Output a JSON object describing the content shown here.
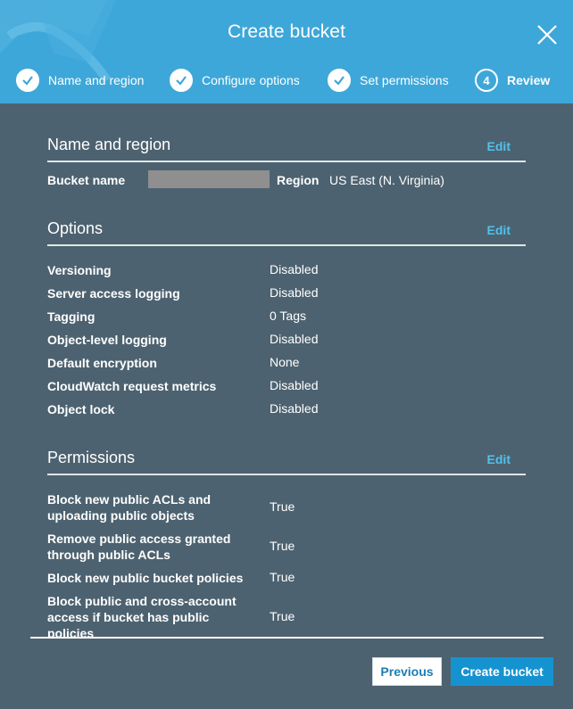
{
  "header": {
    "title": "Create bucket",
    "steps": [
      {
        "label": "Name and region",
        "state": "done"
      },
      {
        "label": "Configure options",
        "state": "done"
      },
      {
        "label": "Set permissions",
        "state": "done"
      },
      {
        "label": "Review",
        "number": "4",
        "state": "active"
      }
    ]
  },
  "name_region": {
    "title": "Name and region",
    "edit": "Edit",
    "bucket_name_label": "Bucket name",
    "region_label": "Region",
    "region_value": "US East (N. Virginia)"
  },
  "options": {
    "title": "Options",
    "edit": "Edit",
    "rows": [
      {
        "key": "Versioning",
        "value": "Disabled"
      },
      {
        "key": "Server access logging",
        "value": "Disabled"
      },
      {
        "key": "Tagging",
        "value": "0 Tags"
      },
      {
        "key": "Object-level logging",
        "value": "Disabled"
      },
      {
        "key": "Default encryption",
        "value": "None"
      },
      {
        "key": "CloudWatch request metrics",
        "value": "Disabled"
      },
      {
        "key": "Object lock",
        "value": "Disabled"
      }
    ]
  },
  "permissions": {
    "title": "Permissions",
    "edit": "Edit",
    "rows": [
      {
        "key_line1": "Block new public ACLs and",
        "key_line2": "uploading public objects",
        "value": "True"
      },
      {
        "key_line1": "Remove public access granted",
        "key_line2": "through public ACLs",
        "value": "True"
      },
      {
        "key_line1": "Block new public bucket policies",
        "value": "True"
      },
      {
        "key_line1": "Block public and cross-account",
        "key_line2": "access if bucket has public",
        "key_line3": "policies",
        "value": "True"
      }
    ]
  },
  "footer": {
    "previous_label": "Previous",
    "create_label": "Create bucket"
  },
  "colors": {
    "header_bg": "#3ea7d9",
    "body_bg": "#4d6270",
    "link": "#51c1ec",
    "primary_button": "#1593d0"
  }
}
